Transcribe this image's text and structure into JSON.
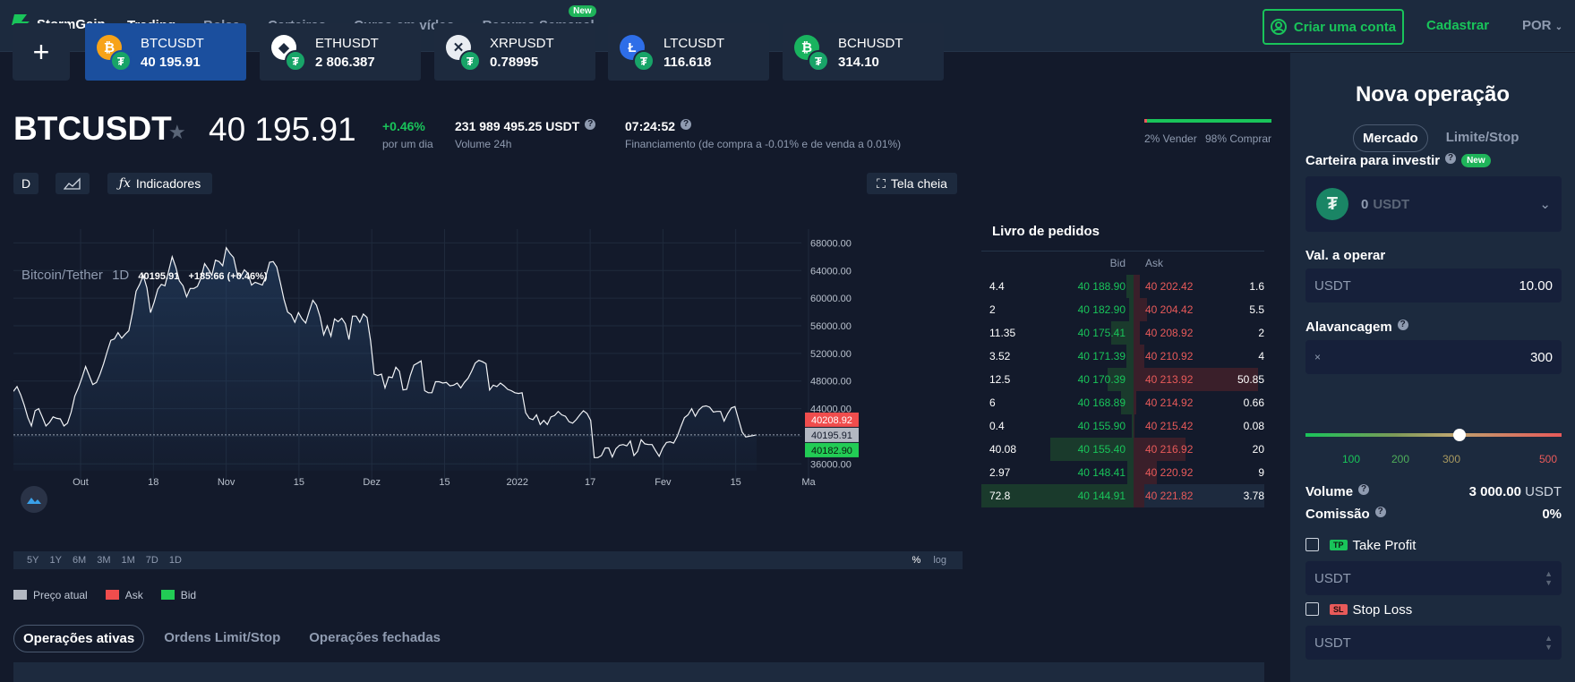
{
  "brand": {
    "name": "StormGain"
  },
  "nav": {
    "items": [
      "Trading",
      "Bolsa",
      "Carteiras",
      "Curso em vídeo",
      "Resumo Semanal"
    ],
    "new_badge": "New"
  },
  "header": {
    "create_account": "Criar uma conta",
    "register": "Cadastrar",
    "language": "POR"
  },
  "tickers": [
    {
      "symbol": "BTCUSDT",
      "price": "40 195.91",
      "icon": "bitcoin-icon",
      "color": "#f7a319"
    },
    {
      "symbol": "ETHUSDT",
      "price": "2 806.387",
      "icon": "ethereum-icon",
      "color": "#ffffff"
    },
    {
      "symbol": "XRPUSDT",
      "price": "0.78995",
      "icon": "xrp-icon",
      "color": "#e9edf2"
    },
    {
      "symbol": "LTCUSDT",
      "price": "116.618",
      "icon": "litecoin-icon",
      "color": "#2e6ee8"
    },
    {
      "symbol": "BCHUSDT",
      "price": "314.10",
      "icon": "bitcoin-cash-icon",
      "color": "#19b35f"
    }
  ],
  "instrument": {
    "symbol": "BTCUSDT",
    "price": "40 195.91",
    "change": "+0.46%",
    "change_label": "por um dia",
    "volume": "231 989 495.25 USDT",
    "volume_label": "Volume 24h",
    "funding_time": "07:24:52",
    "funding_label": "Financiamento (de compra a -0.01% e de venda a 0.01%)",
    "sell_pct": "2% Vender",
    "buy_pct": "98% Comprar",
    "buy_fraction": 0.98
  },
  "toolbar": {
    "interval": "D",
    "indicators": "Indicadores",
    "fullscreen": "Tela cheia"
  },
  "chart_data": {
    "type": "line",
    "title": "Bitcoin/Tether",
    "interval": "1D",
    "last": "40195.91",
    "change": "+185.66 (+0.46%)",
    "x_ticks": [
      "Out",
      "18",
      "Nov",
      "15",
      "Dez",
      "15",
      "2022",
      "17",
      "Fev",
      "15",
      "Ma"
    ],
    "y_ticks": [
      "68000.00",
      "64000.00",
      "60000.00",
      "56000.00",
      "52000.00",
      "48000.00",
      "44000.00",
      "40000.00",
      "36000.00"
    ],
    "ylim": [
      35000,
      70000
    ],
    "price_labels": {
      "ask": "40208.92",
      "current": "40195.91",
      "bid": "40182.90"
    },
    "values": [
      46500,
      47200,
      46000,
      44500,
      42700,
      41500,
      43700,
      44000,
      42800,
      41500,
      42000,
      42800,
      42600,
      42500,
      41500,
      41900,
      43500,
      45800,
      47000,
      48500,
      50100,
      48800,
      47500,
      47800,
      49000,
      50500,
      52300,
      53900,
      54100,
      55000,
      54200,
      54800,
      55300,
      57900,
      61000,
      62000,
      63300,
      61500,
      57900,
      59400,
      61300,
      62000,
      61800,
      63900,
      66000,
      64500,
      62500,
      61800,
      60200,
      61400,
      61400,
      61700,
      62900,
      65000,
      64200,
      63300,
      65500,
      65300,
      64700,
      67300,
      66500,
      65900,
      63600,
      63100,
      64100,
      63600,
      61900,
      62300,
      62100,
      61900,
      63200,
      65200,
      65300,
      64500,
      62200,
      59800,
      58000,
      57600,
      56500,
      57900,
      57000,
      56400,
      58100,
      59700,
      59000,
      57300,
      54700,
      56000,
      54500,
      57000,
      56600,
      57100,
      56300,
      54000,
      57400,
      57400,
      56500,
      57700,
      57200,
      53800,
      49000,
      48800,
      49000,
      47000,
      48600,
      48500,
      50000,
      49400,
      46700,
      46800,
      48800,
      50300,
      50600,
      50900,
      46600,
      46300,
      46300,
      47900,
      47900,
      47700,
      47800,
      47300,
      47400,
      47700,
      47000,
      47800,
      48400,
      49400,
      50600,
      51000,
      50800,
      50500,
      46700,
      47400,
      47200,
      47700,
      47300,
      46800,
      46600,
      46300,
      46200,
      46300,
      43400,
      42600,
      42400,
      43100,
      41700,
      42300,
      41700,
      42800,
      43000,
      43600,
      43100,
      42900,
      42100,
      41900,
      42400,
      43100,
      43700,
      43300,
      42300,
      36900,
      36900,
      37200,
      38300,
      38300,
      37000,
      38200,
      38700,
      38800,
      38600,
      39300,
      37200,
      37800,
      39500,
      38900,
      38800,
      38800,
      37900,
      37100,
      38300,
      39100,
      39200,
      39000,
      40000,
      41400,
      42700,
      43100,
      44000,
      42900,
      43800,
      44300,
      44400,
      44200,
      43500,
      43600,
      43600,
      42200,
      43300,
      44100,
      44300,
      42400,
      40600,
      39900,
      40000,
      40100,
      40200
    ],
    "ranges": [
      "5Y",
      "1Y",
      "6M",
      "3M",
      "1M",
      "7D",
      "1D"
    ],
    "scale": [
      "%",
      "log"
    ]
  },
  "legend": [
    "Preço atual",
    "Ask",
    "Bid"
  ],
  "bottom_tabs": [
    "Operações ativas",
    "Ordens Limit/Stop",
    "Operações fechadas"
  ],
  "orderbook": {
    "title": "Livro de pedidos",
    "bid_label": "Bid",
    "ask_label": "Ask",
    "rows": [
      {
        "bq": "4.4",
        "bid": "40 188.90",
        "ask": "40 202.42",
        "aq": "1.6",
        "bw": 0.05,
        "aw": 0.05
      },
      {
        "bq": "2",
        "bid": "40 182.90",
        "ask": "40 204.42",
        "aq": "5.5",
        "bw": 0.03,
        "aw": 0.1
      },
      {
        "bq": "11.35",
        "bid": "40 175.41",
        "ask": "40 208.92",
        "aq": "2",
        "bw": 0.15,
        "aw": 0.05
      },
      {
        "bq": "3.52",
        "bid": "40 171.39",
        "ask": "40 210.92",
        "aq": "4",
        "bw": 0.05,
        "aw": 0.08
      },
      {
        "bq": "12.5",
        "bid": "40 170.39",
        "ask": "40 213.92",
        "aq": "50.85",
        "bw": 0.17,
        "aw": 0.95
      },
      {
        "bq": "6",
        "bid": "40 168.89",
        "ask": "40 214.92",
        "aq": "0.66",
        "bw": 0.08,
        "aw": 0.02
      },
      {
        "bq": "0.4",
        "bid": "40 155.90",
        "ask": "40 215.42",
        "aq": "0.08",
        "bw": 0.01,
        "aw": 0.01
      },
      {
        "bq": "40.08",
        "bid": "40 155.40",
        "ask": "40 216.92",
        "aq": "20",
        "bw": 0.55,
        "aw": 0.4
      },
      {
        "bq": "2.97",
        "bid": "40 148.41",
        "ask": "40 220.92",
        "aq": "9",
        "bw": 0.04,
        "aw": 0.18
      },
      {
        "bq": "72.8",
        "bid": "40 144.91",
        "ask": "40 221.82",
        "aq": "3.78",
        "bw": 1.0,
        "aw": 0.08
      }
    ]
  },
  "order_panel": {
    "title": "Nova operação",
    "tab_market": "Mercado",
    "tab_limit": "Limite/Stop",
    "wallet_label": "Carteira para investir",
    "wallet_new": "New",
    "wallet_value": "0",
    "wallet_unit": "USDT",
    "amount_label": "Val. a operar",
    "amount_unit": "USDT",
    "amount_value": "10.00",
    "leverage_label": "Alavancagem",
    "leverage_prefix": "×",
    "leverage_value": "300",
    "leverage_marks": [
      "100",
      "200",
      "300",
      "500"
    ],
    "leverage_fraction": 0.6,
    "volume_label": "Volume",
    "volume_value": "3 000.00",
    "volume_unit": "USDT",
    "commission_label": "Comissão",
    "commission_value": "0%",
    "tp_tag": "TP",
    "tp_label": "Take Profit",
    "tp_unit": "USDT",
    "sl_tag": "SL",
    "sl_label": "Stop Loss",
    "sl_unit": "USDT"
  }
}
